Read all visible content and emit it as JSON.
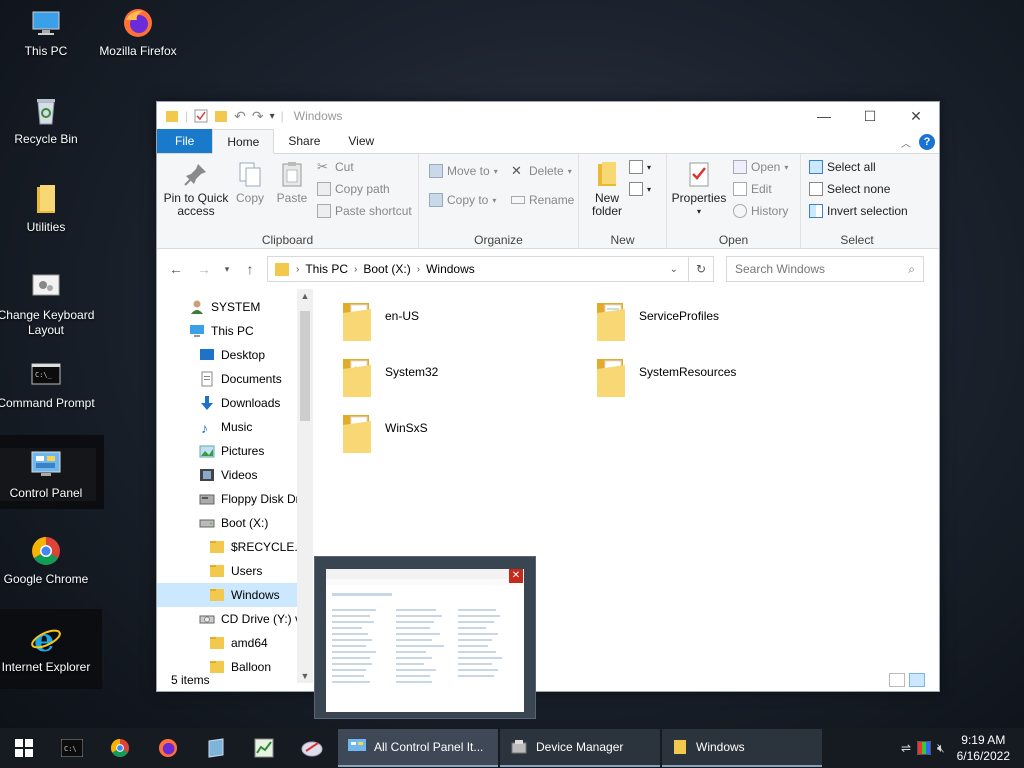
{
  "desktop": {
    "icons": [
      {
        "label": "This PC"
      },
      {
        "label": "Mozilla Firefox"
      },
      {
        "label": "Recycle Bin"
      },
      {
        "label": "Utilities"
      },
      {
        "label": "Change Keyboard Layout"
      },
      {
        "label": "Command Prompt"
      },
      {
        "label": "Control Panel"
      },
      {
        "label": "Google Chrome"
      },
      {
        "label": "Internet Explorer"
      }
    ]
  },
  "window": {
    "title": "Windows",
    "tabs": {
      "file": "File",
      "home": "Home",
      "share": "Share",
      "view": "View"
    },
    "ribbon": {
      "clipboard": {
        "label": "Clipboard",
        "pin": "Pin to Quick access",
        "copy": "Copy",
        "paste": "Paste",
        "cut": "Cut",
        "copy_path": "Copy path",
        "paste_shortcut": "Paste shortcut"
      },
      "organize": {
        "label": "Organize",
        "move_to": "Move to",
        "copy_to": "Copy to",
        "delete": "Delete",
        "rename": "Rename"
      },
      "new": {
        "label": "New",
        "new_folder": "New folder"
      },
      "open": {
        "label": "Open",
        "properties": "Properties",
        "open": "Open",
        "edit": "Edit",
        "history": "History"
      },
      "select": {
        "label": "Select",
        "select_all": "Select all",
        "select_none": "Select none",
        "invert": "Invert selection"
      }
    },
    "address": {
      "crumbs": [
        "This PC",
        "Boot (X:)",
        "Windows"
      ],
      "search_placeholder": "Search Windows"
    },
    "nav": [
      {
        "label": "SYSTEM",
        "indent": 0
      },
      {
        "label": "This PC",
        "indent": 0
      },
      {
        "label": "Desktop",
        "indent": 1
      },
      {
        "label": "Documents",
        "indent": 1
      },
      {
        "label": "Downloads",
        "indent": 1
      },
      {
        "label": "Music",
        "indent": 1
      },
      {
        "label": "Pictures",
        "indent": 1
      },
      {
        "label": "Videos",
        "indent": 1
      },
      {
        "label": "Floppy Disk Dri",
        "indent": 1
      },
      {
        "label": "Boot (X:)",
        "indent": 1
      },
      {
        "label": "$RECYCLE.BIN",
        "indent": 2
      },
      {
        "label": "Users",
        "indent": 2
      },
      {
        "label": "Windows",
        "indent": 2
      },
      {
        "label": "CD Drive (Y:) vi",
        "indent": 1
      },
      {
        "label": "amd64",
        "indent": 2
      },
      {
        "label": "Balloon",
        "indent": 2
      }
    ],
    "files": [
      "en-US",
      "ServiceProfiles",
      "System32",
      "SystemResources",
      "WinSxS"
    ],
    "status": "5 items"
  },
  "taskbar": {
    "tasks": [
      "All Control Panel It...",
      "Device Manager",
      "Windows"
    ],
    "time": "9:19 AM",
    "date": "6/16/2022"
  },
  "colors": {
    "accent": "#1979ca",
    "folder": "#f3c94d",
    "selection": "#cce8ff"
  }
}
